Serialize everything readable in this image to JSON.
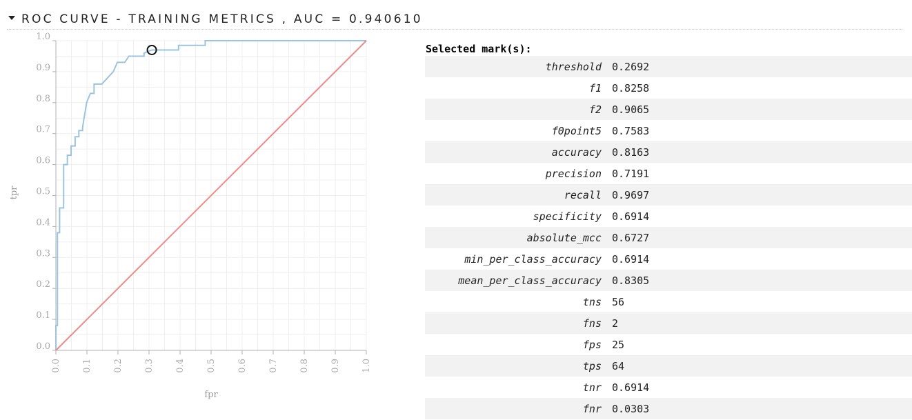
{
  "header": {
    "title": "ROC CURVE - TRAINING METRICS , AUC = 0.940610"
  },
  "chart_data": {
    "type": "line",
    "title": "ROC CURVE - TRAINING METRICS , AUC = 0.940610",
    "xlabel": "fpr",
    "ylabel": "tpr",
    "xlim": [
      0,
      1
    ],
    "ylim": [
      0,
      1
    ],
    "grid": true,
    "x_ticks": [
      "0.0",
      "0.1",
      "0.2",
      "0.3",
      "0.4",
      "0.5",
      "0.6",
      "0.7",
      "0.8",
      "0.9",
      "1.0"
    ],
    "y_ticks": [
      "0.0",
      "0.1",
      "0.2",
      "0.3",
      "0.4",
      "0.5",
      "0.6",
      "0.7",
      "0.8",
      "0.9",
      "1.0"
    ],
    "series": [
      {
        "color": "#9cc3dc",
        "x": [
          0,
          0,
          0.005,
          0.005,
          0.005,
          0.012,
          0.012,
          0.012,
          0.012,
          0.025,
          0.025,
          0.025,
          0.037,
          0.037,
          0.049,
          0.049,
          0.062,
          0.062,
          0.074,
          0.074,
          0.086,
          0.086,
          0.099,
          0.099,
          0.111,
          0.123,
          0.123,
          0.148,
          0.185,
          0.185,
          0.198,
          0.198,
          0.222,
          0.235,
          0.235,
          0.284,
          0.284,
          0.309,
          0.395,
          0.395,
          0.481,
          0.481,
          0.5,
          1.0
        ],
        "y": [
          0,
          0.08,
          0.08,
          0.37,
          0.38,
          0.38,
          0.39,
          0.45,
          0.46,
          0.46,
          0.6,
          0.6,
          0.6,
          0.63,
          0.63,
          0.66,
          0.66,
          0.69,
          0.69,
          0.71,
          0.71,
          0.72,
          0.8,
          0.8,
          0.83,
          0.83,
          0.86,
          0.86,
          0.9,
          0.9,
          0.93,
          0.93,
          0.93,
          0.95,
          0.95,
          0.95,
          0.96,
          0.97,
          0.97,
          0.985,
          0.985,
          1.0,
          1.0,
          1.0
        ]
      },
      {
        "color": "#f08a87",
        "x": [
          0,
          1
        ],
        "y": [
          0,
          1
        ]
      }
    ],
    "selected_point": {
      "x": 0.309,
      "y": 0.97
    }
  },
  "selection": {
    "title": "Selected mark(s):",
    "rows": [
      {
        "name": "threshold",
        "value": "0.2692"
      },
      {
        "name": "f1",
        "value": "0.8258"
      },
      {
        "name": "f2",
        "value": "0.9065"
      },
      {
        "name": "f0point5",
        "value": "0.7583"
      },
      {
        "name": "accuracy",
        "value": "0.8163"
      },
      {
        "name": "precision",
        "value": "0.7191"
      },
      {
        "name": "recall",
        "value": "0.9697"
      },
      {
        "name": "specificity",
        "value": "0.6914"
      },
      {
        "name": "absolute_mcc",
        "value": "0.6727"
      },
      {
        "name": "min_per_class_accuracy",
        "value": "0.6914"
      },
      {
        "name": "mean_per_class_accuracy",
        "value": "0.8305"
      },
      {
        "name": "tns",
        "value": "56"
      },
      {
        "name": "fns",
        "value": "2"
      },
      {
        "name": "fps",
        "value": "25"
      },
      {
        "name": "tps",
        "value": "64"
      },
      {
        "name": "tnr",
        "value": "0.6914"
      },
      {
        "name": "fnr",
        "value": "0.0303"
      }
    ]
  }
}
